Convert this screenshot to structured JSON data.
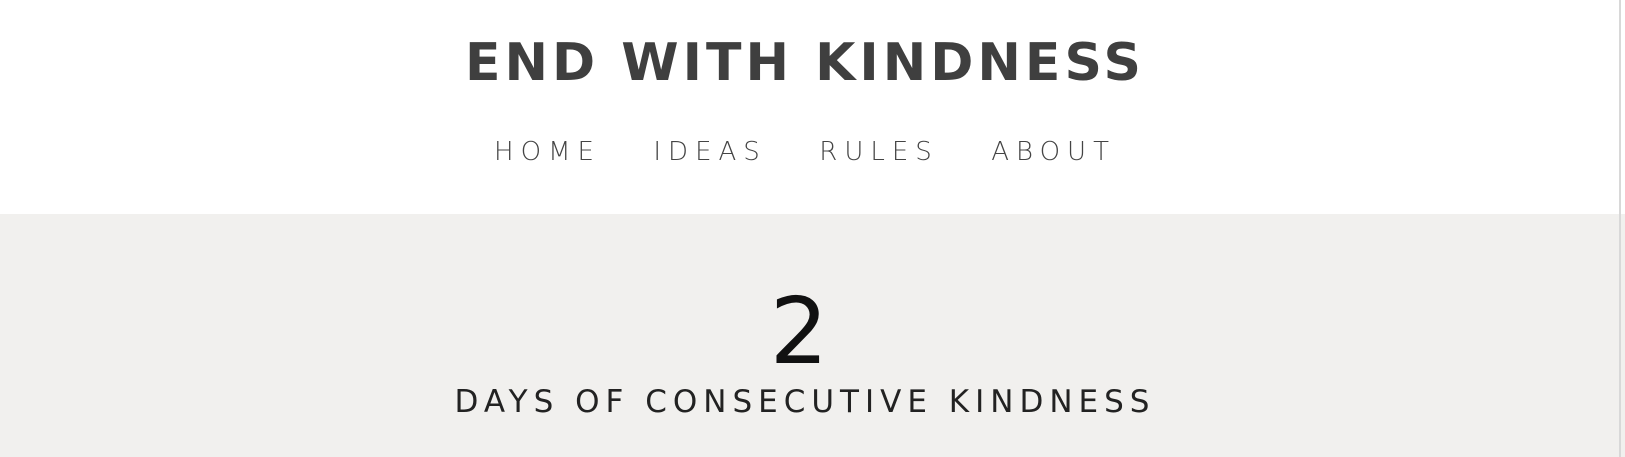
{
  "site": {
    "title": "END WITH KINDNESS"
  },
  "nav": {
    "items": [
      {
        "label": "HOME"
      },
      {
        "label": "IDEAS"
      },
      {
        "label": "RULES"
      },
      {
        "label": "ABOUT"
      }
    ]
  },
  "counter": {
    "value": "2",
    "label": "DAYS OF CONSECUTIVE KINDNESS"
  },
  "colors": {
    "header_background": "#ffffff",
    "section_background": "#f1f0ee",
    "title_text": "#3f3f3f"
  }
}
